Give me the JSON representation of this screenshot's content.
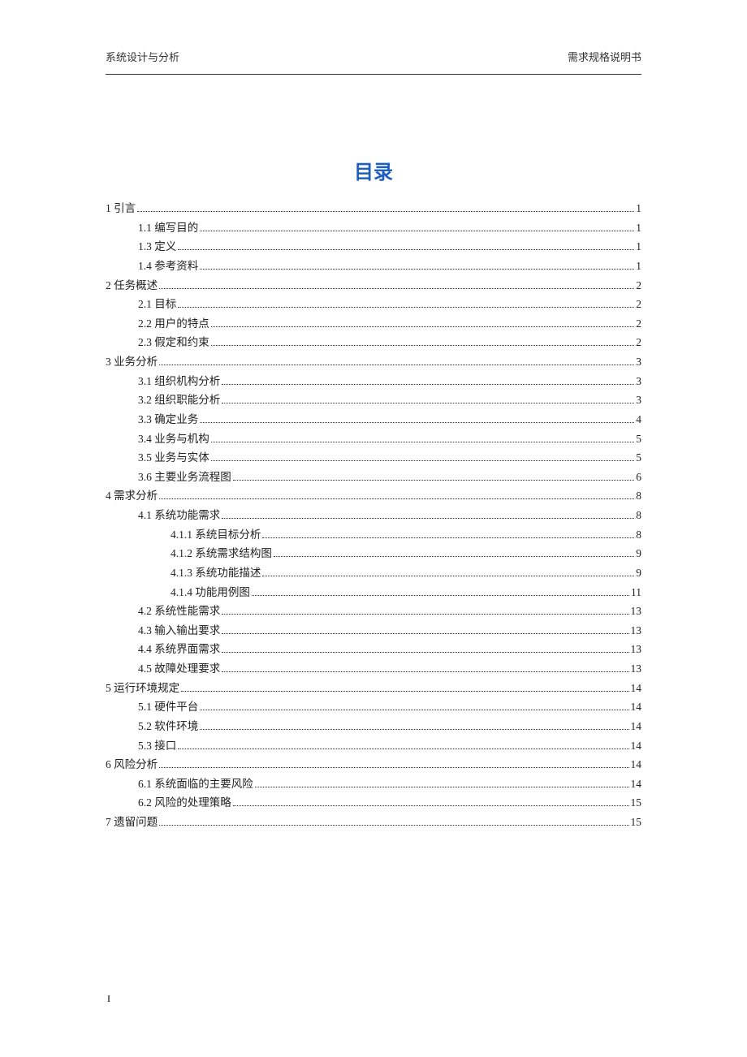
{
  "header": {
    "left": "系统设计与分析",
    "right": "需求规格说明书"
  },
  "title": "目录",
  "toc": [
    {
      "level": 0,
      "label": "1 引言",
      "page": "1"
    },
    {
      "level": 1,
      "label": "1.1 编写目的",
      "page": "1"
    },
    {
      "level": 1,
      "label": "1.3 定义",
      "page": "1"
    },
    {
      "level": 1,
      "label": "1.4 参考资料",
      "page": "1"
    },
    {
      "level": 0,
      "label": "2 任务概述",
      "page": "2"
    },
    {
      "level": 1,
      "label": "2.1 目标",
      "page": "2"
    },
    {
      "level": 1,
      "label": "2.2 用户的特点",
      "page": "2"
    },
    {
      "level": 1,
      "label": "2.3 假定和约束",
      "page": "2"
    },
    {
      "level": 0,
      "label": "3 业务分析",
      "page": "3"
    },
    {
      "level": 1,
      "label": "3.1 组织机构分析",
      "page": "3"
    },
    {
      "level": 1,
      "label": "3.2 组织职能分析",
      "page": "3"
    },
    {
      "level": 1,
      "label": "3.3 确定业务",
      "page": "4"
    },
    {
      "level": 1,
      "label": "3.4 业务与机构",
      "page": "5"
    },
    {
      "level": 1,
      "label": "3.5 业务与实体",
      "page": "5"
    },
    {
      "level": 1,
      "label": "3.6 主要业务流程图",
      "page": "6"
    },
    {
      "level": 0,
      "label": "4 需求分析",
      "page": "8"
    },
    {
      "level": 1,
      "label": "4.1 系统功能需求",
      "page": "8"
    },
    {
      "level": 2,
      "label": "4.1.1 系统目标分析",
      "page": "8"
    },
    {
      "level": 2,
      "label": "4.1.2 系统需求结构图",
      "page": "9"
    },
    {
      "level": 2,
      "label": "4.1.3 系统功能描述",
      "page": "9"
    },
    {
      "level": 2,
      "label": "4.1.4 功能用例图",
      "page": "11"
    },
    {
      "level": 1,
      "label": "4.2 系统性能需求",
      "page": "13"
    },
    {
      "level": 1,
      "label": "4.3 输入输出要求",
      "page": "13"
    },
    {
      "level": 1,
      "label": "4.4  系统界面需求",
      "page": "13"
    },
    {
      "level": 1,
      "label": "4.5 故障处理要求",
      "page": "13"
    },
    {
      "level": 0,
      "label": "5 运行环境规定",
      "page": "14"
    },
    {
      "level": 1,
      "label": "5.1 硬件平台",
      "page": "14"
    },
    {
      "level": 1,
      "label": "5.2 软件环境",
      "page": "14"
    },
    {
      "level": 1,
      "label": "5.3 接口",
      "page": "14"
    },
    {
      "level": 0,
      "label": "6  风险分析",
      "page": "14"
    },
    {
      "level": 1,
      "label": "6.1 系统面临的主要风险",
      "page": "14"
    },
    {
      "level": 1,
      "label": "6.2 风险的处理策略",
      "page": "15"
    },
    {
      "level": 0,
      "label": "7 遗留问题",
      "page": "15"
    }
  ],
  "footer_page": "I"
}
